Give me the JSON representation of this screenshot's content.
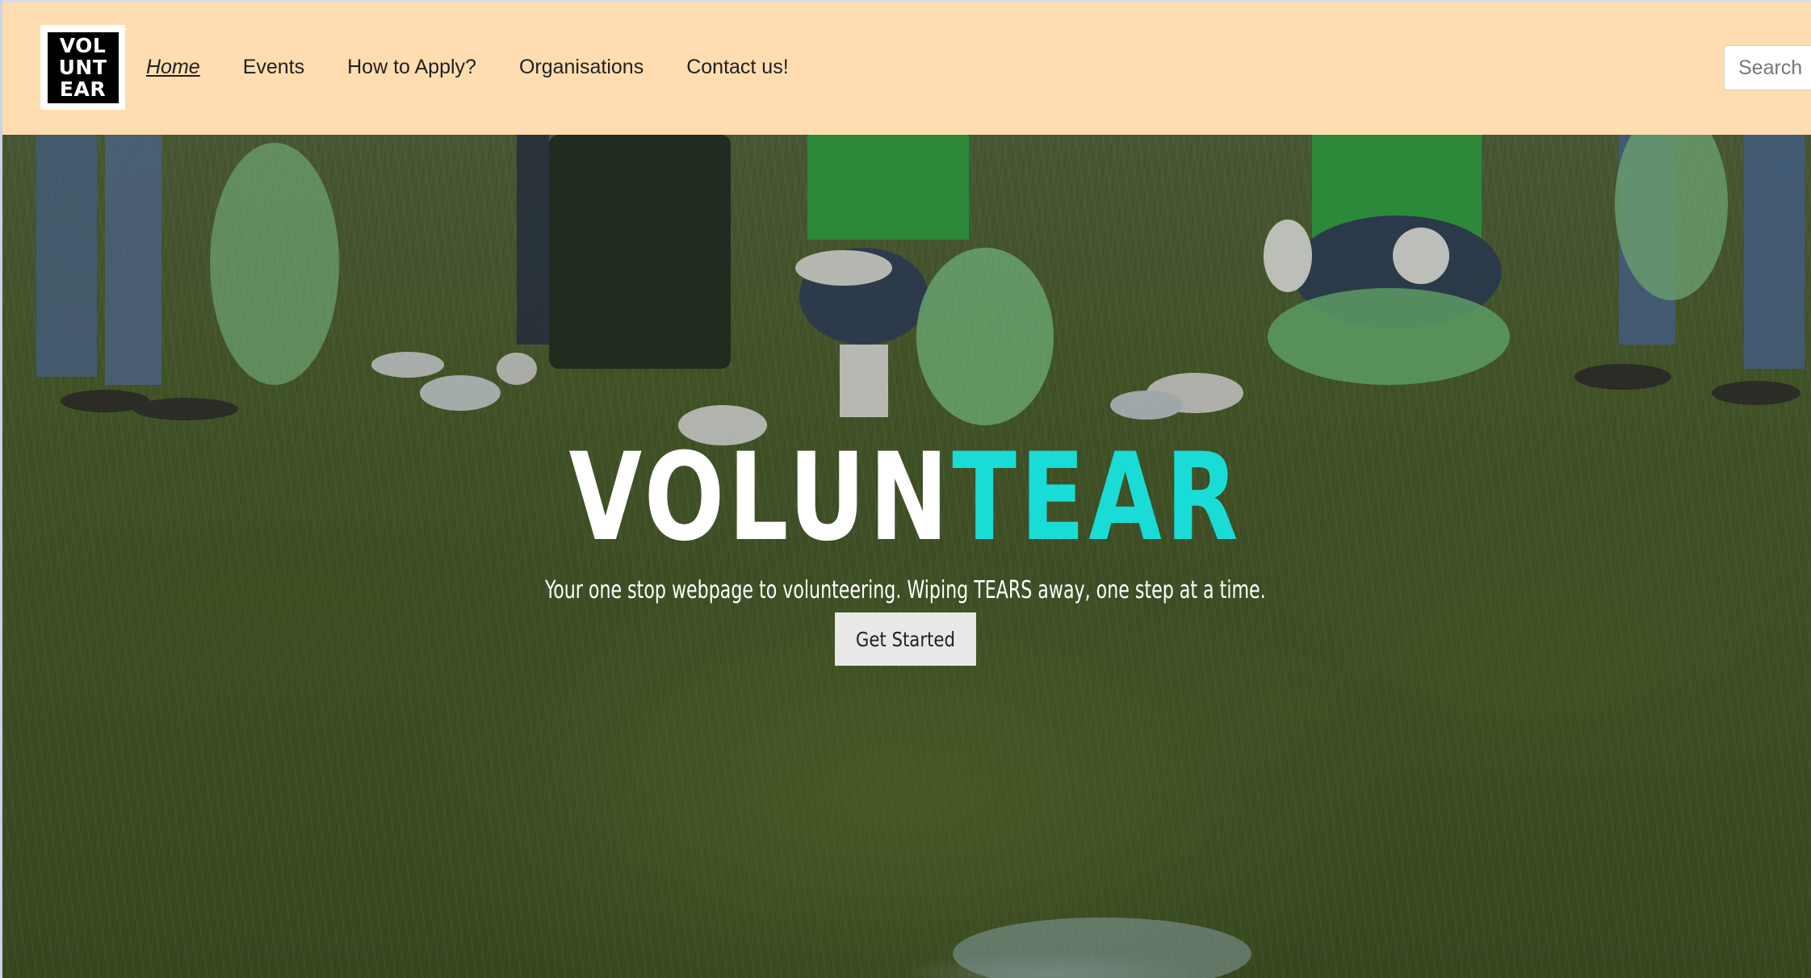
{
  "logo": {
    "lines": [
      "VOL",
      "UNT",
      "EAR"
    ]
  },
  "nav": {
    "items": [
      {
        "label": "Home",
        "active": true
      },
      {
        "label": "Events",
        "active": false
      },
      {
        "label": "How to Apply?",
        "active": false
      },
      {
        "label": "Organisations",
        "active": false
      },
      {
        "label": "Contact us!",
        "active": false
      }
    ]
  },
  "search": {
    "placeholder": "Search",
    "value": ""
  },
  "hero": {
    "title_part1": "VOLUN",
    "title_part2": "TEAR",
    "tagline": "Your one stop webpage to volunteering. Wiping TEARS away, one step at a time.",
    "button_label": "Get Started"
  },
  "colors": {
    "navbar_bg": "#ffddb0",
    "accent": "#19dcd6",
    "button_bg": "#e8e8e8"
  }
}
